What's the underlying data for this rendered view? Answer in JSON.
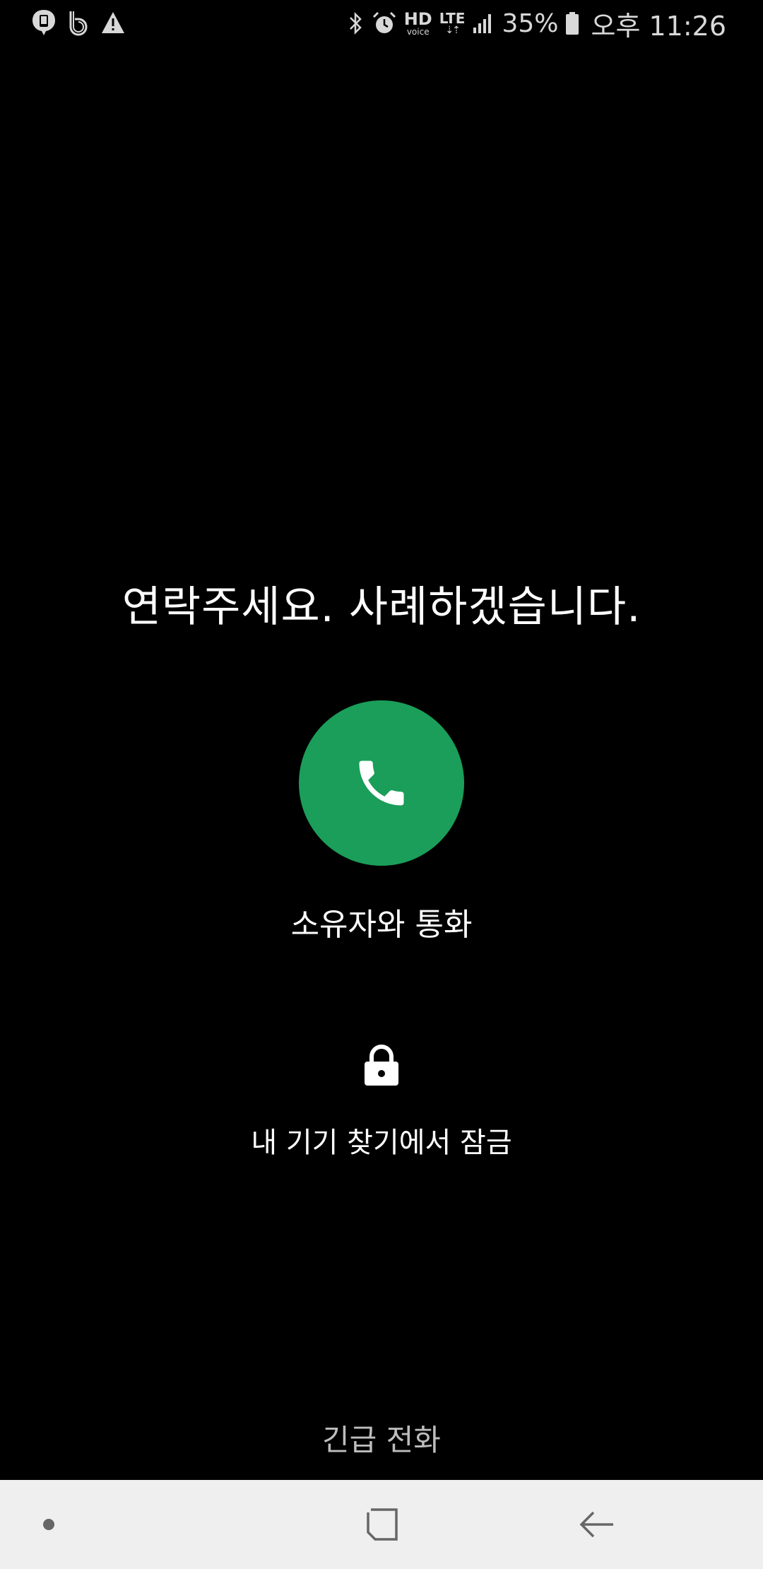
{
  "status_bar": {
    "left_icons": [
      "messenger-notification-icon",
      "b-app-notification-icon",
      "warning-icon"
    ],
    "right_icons": [
      "bluetooth-icon",
      "alarm-icon",
      "hd-voice-icon",
      "lte-icon",
      "signal-icon",
      "battery-icon"
    ],
    "hd_label": "HD",
    "voice_label": "voice",
    "lte_label": "LTE",
    "battery_percent": "35%",
    "time": "오후 11:26"
  },
  "lock_screen": {
    "message": "연락주세요. 사례하겠습니다.",
    "call_owner_label": "소유자와 통화",
    "lock_status_label": "내 기기 찾기에서 잠금",
    "emergency_call_label": "긴급 전화"
  },
  "colors": {
    "background": "#000000",
    "call_button": "#1a9e5a",
    "nav_bar": "#efefef",
    "status_text": "#d8d8d8",
    "emergency_text": "#bdbdbd"
  },
  "nav_bar": {
    "buttons": [
      "nav-dot-icon",
      "recents-icon",
      "back-icon"
    ]
  }
}
